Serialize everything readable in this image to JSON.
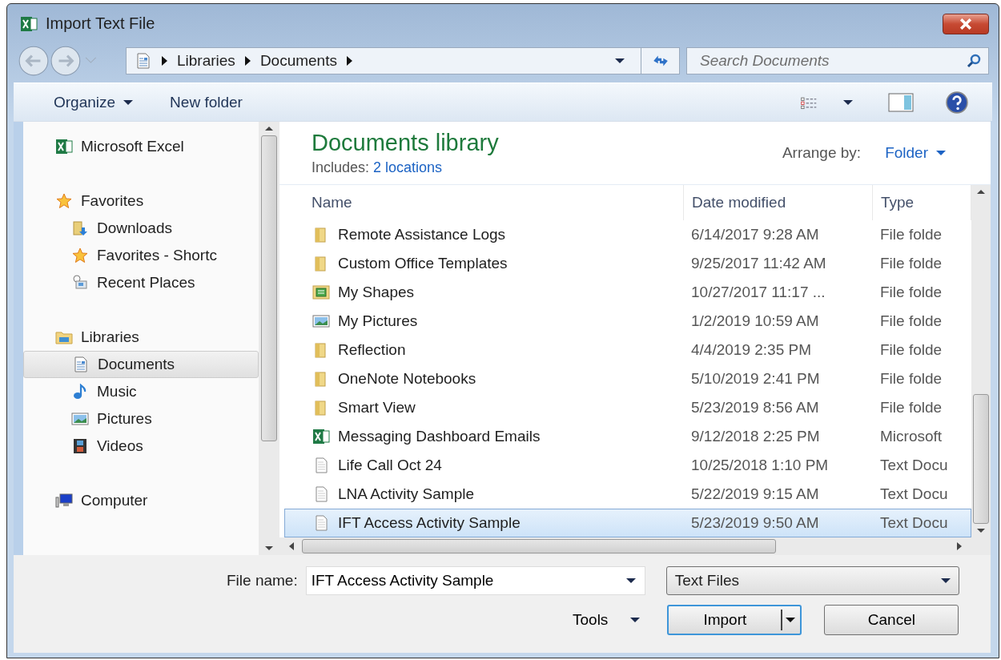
{
  "window": {
    "title": "Import Text File"
  },
  "address": {
    "crumbs": [
      "Libraries",
      "Documents"
    ]
  },
  "search": {
    "placeholder": "Search Documents"
  },
  "toolbar": {
    "organize": "Organize",
    "new_folder": "New folder"
  },
  "sidebar": [
    {
      "label": "Microsoft Excel",
      "kind": "excel",
      "selected": false
    },
    {
      "label": "Favorites",
      "kind": "star",
      "selected": false,
      "children": [
        {
          "label": "Downloads",
          "kind": "downloads",
          "selected": false
        },
        {
          "label": "Favorites - Shortc",
          "kind": "star",
          "selected": false
        },
        {
          "label": "Recent Places",
          "kind": "recent",
          "selected": false
        }
      ]
    },
    {
      "label": "Libraries",
      "kind": "library",
      "selected": false,
      "children": [
        {
          "label": "Documents",
          "kind": "document",
          "selected": true
        },
        {
          "label": "Music",
          "kind": "music",
          "selected": false
        },
        {
          "label": "Pictures",
          "kind": "pictures",
          "selected": false
        },
        {
          "label": "Videos",
          "kind": "videos",
          "selected": false
        }
      ]
    },
    {
      "label": "Computer",
      "kind": "computer",
      "selected": false
    }
  ],
  "library": {
    "title": "Documents library",
    "includes_label": "Includes:",
    "includes_link": "2 locations",
    "arrange_label": "Arrange by:",
    "arrange_value": "Folder"
  },
  "columns": [
    "Name",
    "Date modified",
    "Type"
  ],
  "rows": [
    {
      "name": "Remote Assistance Logs",
      "date": "6/14/2017 9:28 AM",
      "type": "File folde",
      "kind": "folder",
      "selected": false
    },
    {
      "name": "Custom Office Templates",
      "date": "9/25/2017 11:42 AM",
      "type": "File folde",
      "kind": "folder",
      "selected": false
    },
    {
      "name": "My Shapes",
      "date": "10/27/2017 11:17 ...",
      "type": "File folde",
      "kind": "shapes",
      "selected": false
    },
    {
      "name": "My Pictures",
      "date": "1/2/2019 10:59 AM",
      "type": "File folde",
      "kind": "pictures",
      "selected": false
    },
    {
      "name": "Reflection",
      "date": "4/4/2019 2:35 PM",
      "type": "File folde",
      "kind": "folder",
      "selected": false
    },
    {
      "name": "OneNote Notebooks",
      "date": "5/10/2019 2:41 PM",
      "type": "File folde",
      "kind": "folder",
      "selected": false
    },
    {
      "name": "Smart View",
      "date": "5/23/2019 8:56 AM",
      "type": "File folde",
      "kind": "folder",
      "selected": false
    },
    {
      "name": "Messaging Dashboard Emails",
      "date": "9/12/2018 2:25 PM",
      "type": "Microsoft",
      "kind": "excel",
      "selected": false
    },
    {
      "name": "Life Call Oct 24",
      "date": "10/25/2018 1:10 PM",
      "type": "Text Docu",
      "kind": "text",
      "selected": false
    },
    {
      "name": "LNA Activity Sample",
      "date": "5/22/2019 9:15 AM",
      "type": "Text Docu",
      "kind": "text",
      "selected": false
    },
    {
      "name": "IFT Access Activity Sample",
      "date": "5/23/2019 9:50 AM",
      "type": "Text Docu",
      "kind": "text",
      "selected": true
    }
  ],
  "footer": {
    "filename_label": "File name:",
    "filename_value": "IFT Access Activity Sample",
    "filetype": "Text Files",
    "tools": "Tools",
    "import": "Import",
    "cancel": "Cancel"
  }
}
